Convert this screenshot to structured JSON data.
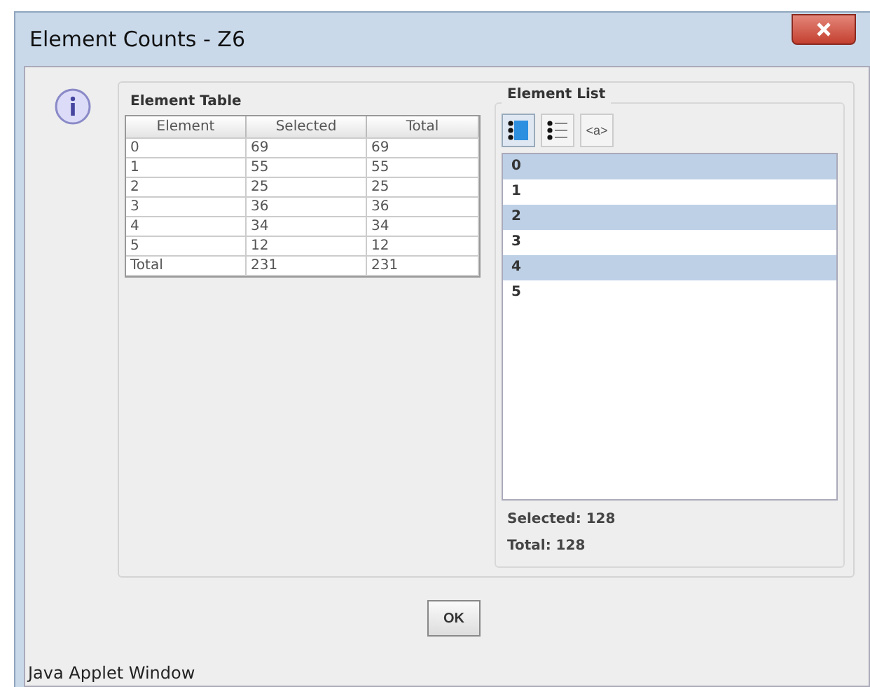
{
  "window": {
    "title": "Element Counts  - Z6"
  },
  "element_table": {
    "title": "Element Table",
    "columns": [
      "Element",
      "Selected",
      "Total"
    ],
    "rows": [
      [
        "0",
        "69",
        "69"
      ],
      [
        "1",
        "55",
        "55"
      ],
      [
        "2",
        "25",
        "25"
      ],
      [
        "3",
        "36",
        "36"
      ],
      [
        "4",
        "34",
        "34"
      ],
      [
        "5",
        "12",
        "12"
      ],
      [
        "Total",
        "231",
        "231"
      ]
    ]
  },
  "element_list": {
    "title": "Element List",
    "toolbar": [
      {
        "kind": "list-detail",
        "selected": true
      },
      {
        "kind": "list",
        "selected": false
      },
      {
        "kind": "text",
        "label": "<a>",
        "selected": false
      }
    ],
    "items": [
      {
        "label": "0",
        "selected": true
      },
      {
        "label": "1",
        "selected": false
      },
      {
        "label": "2",
        "selected": true
      },
      {
        "label": "3",
        "selected": false
      },
      {
        "label": "4",
        "selected": true
      },
      {
        "label": "5",
        "selected": false
      }
    ],
    "selected": "Selected:  128",
    "total": "Total:  128"
  },
  "buttons": [
    "OK"
  ],
  "status_bar": "Java Applet Window"
}
